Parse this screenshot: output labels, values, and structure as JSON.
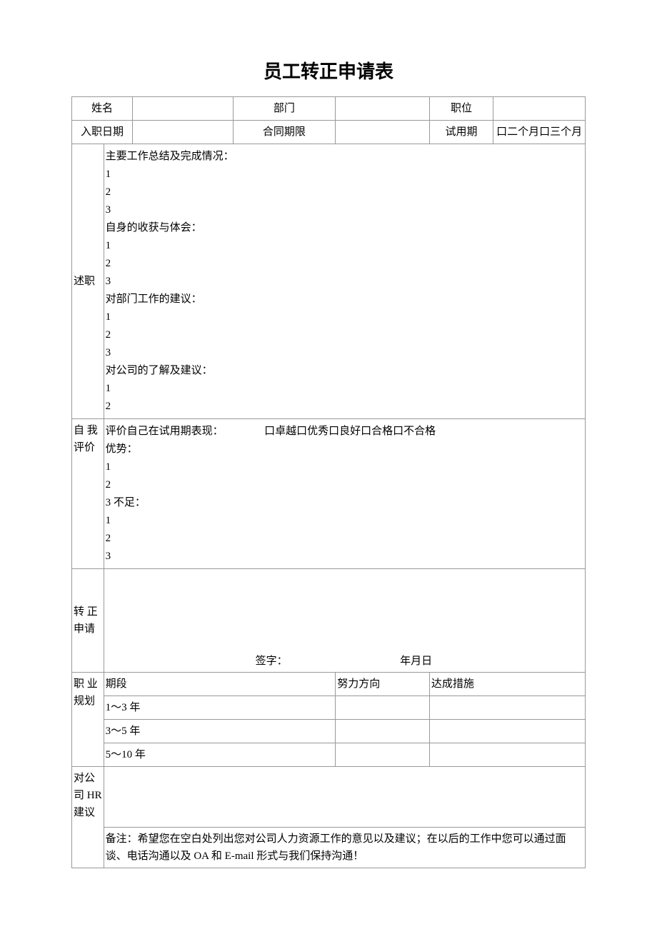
{
  "title": "员工转正申请表",
  "row1": {
    "nameLabel": "姓名",
    "deptLabel": "部门",
    "posLabel": "职位"
  },
  "row2": {
    "entryDateLabel": "入职日期",
    "contractLabel": "合同期限",
    "probLabel": "试用期",
    "probOptions": "口二个月口三个月"
  },
  "section3": {
    "label": "述职",
    "p1": "主要工作总结及完成情况：",
    "n1": "1",
    "n2": "2",
    "n3": "3",
    "p2": "自身的收获与体会：",
    "n4": "1",
    "n5": "2",
    "n6": "3",
    "p3": "对部门工作的建议：",
    "n7": "1",
    "n8": "2",
    "n9": "3",
    "p4": "对公司的了解及建议：",
    "n10": "1",
    "n11": "2"
  },
  "section4": {
    "label": "自 我评价",
    "evalText": "评价自己在试用期表现：",
    "evalOptions": "口卓越口优秀口良好口合格口不合格",
    "p1": "优势：",
    "n1": "1",
    "n2": "2",
    "p2": "3 不足：",
    "n3": "1",
    "n4": "2",
    "n5": "3"
  },
  "section5": {
    "label": "转 正申请",
    "signLabel": "签字：",
    "dateLabel": "年月日"
  },
  "section6": {
    "label": "职 业规划",
    "h1": "期段",
    "h2": "努力方向",
    "h3": "达成措施",
    "r1": "1～3 年",
    "r2": "3～5 年",
    "r3": "5～10 年"
  },
  "section7": {
    "label": "对公司 HR 建议",
    "note": "备注：希望您在空白处列出您对公司人力资源工作的意见以及建议；在以后的工作中您可以通过面谈、电话沟通以及 OA 和 E-mail 形式与我们保持沟通！"
  }
}
